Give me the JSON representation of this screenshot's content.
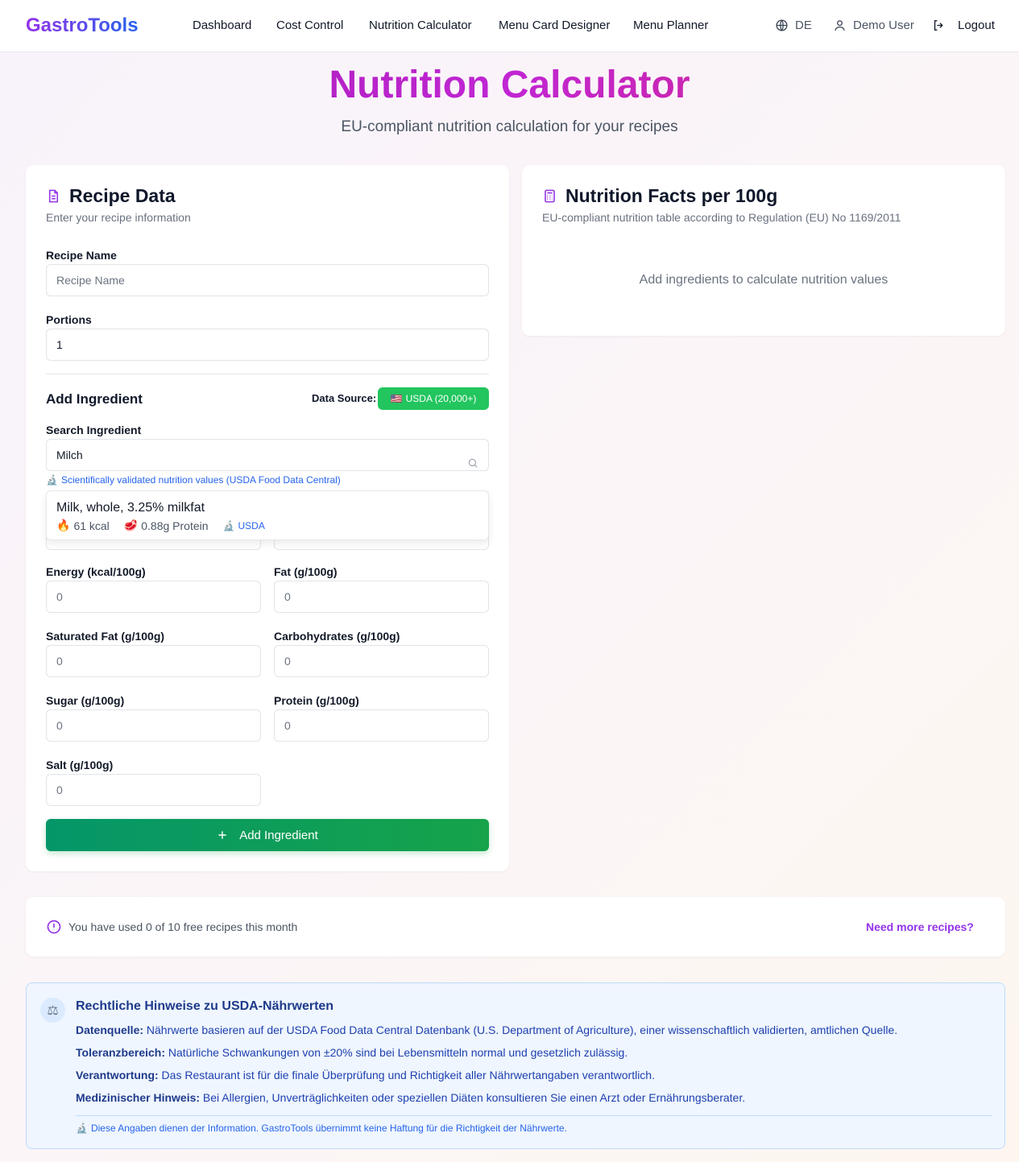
{
  "nav": {
    "logo": "GastroTools",
    "links": [
      "Dashboard",
      "Cost Control",
      "Nutrition Calculator",
      "Menu Card Designer",
      "Menu Planner"
    ],
    "language": "DE",
    "user": "Demo User",
    "logout": "Logout"
  },
  "header": {
    "title": "Nutrition Calculator",
    "subtitle": "EU-compliant nutrition calculation for your recipes"
  },
  "recipe": {
    "title": "Recipe Data",
    "subtitle": "Enter your recipe information",
    "name_label": "Recipe Name",
    "name_placeholder": "Recipe Name",
    "portions_label": "Portions",
    "portions_value": "1",
    "add_heading": "Add Ingredient",
    "data_source_label": "Data Source:",
    "data_source_flag": "🇺🇸",
    "data_source_value": "USDA (20,000+)",
    "search_label": "Search Ingredient",
    "search_value": "Milch",
    "validated_note": "Scientifically validated nutrition values (USDA Food Data Central)",
    "suggestion": {
      "name": "Milk, whole, 3.25% milkfat",
      "kcal": "61 kcal",
      "protein": "0.88g Protein",
      "source": "USDA"
    },
    "fields": [
      {
        "label": "Energy (kcal/100g)",
        "placeholder": "0"
      },
      {
        "label": "Fat (g/100g)",
        "placeholder": "0"
      },
      {
        "label": "Saturated Fat (g/100g)",
        "placeholder": "0"
      },
      {
        "label": "Carbohydrates (g/100g)",
        "placeholder": "0"
      },
      {
        "label": "Sugar (g/100g)",
        "placeholder": "0"
      },
      {
        "label": "Protein (g/100g)",
        "placeholder": "0"
      },
      {
        "label": "Salt (g/100g)",
        "placeholder": "0"
      }
    ],
    "add_button": "Add Ingredient"
  },
  "facts": {
    "title": "Nutrition Facts per 100g",
    "subtitle": "EU-compliant nutrition table according to Regulation (EU) No 1169/2011",
    "empty": "Add ingredients to calculate nutrition values"
  },
  "usage": {
    "text": "You have used 0 of 10 free recipes this month",
    "link": "Need more recipes?"
  },
  "legal": {
    "title": "Rechtliche Hinweise zu USDA-Nährwerten",
    "lines": [
      {
        "label": "Datenquelle:",
        "text": " Nährwerte basieren auf der USDA Food Data Central Datenbank (U.S. Department of Agriculture), einer wissenschaftlich validierten, amtlichen Quelle."
      },
      {
        "label": "Toleranzbereich:",
        "text": " Natürliche Schwankungen von ±20% sind bei Lebensmitteln normal und gesetzlich zulässig."
      },
      {
        "label": "Verantwortung:",
        "text": " Das Restaurant ist für die finale Überprüfung und Richtigkeit aller Nährwertangaben verantwortlich."
      },
      {
        "label": "Medizinischer Hinweis:",
        "text": " Bei Allergien, Unverträglichkeiten oder speziellen Diäten konsultieren Sie einen Arzt oder Ernährungsberater."
      }
    ],
    "footnote": "Diese Angaben dienen der Information. GastroTools übernimmt keine Haftung für die Richtigkeit der Nährwerte."
  },
  "colors": {
    "accent": "#9333ea",
    "success": "#22c55e",
    "info": "#1e40af"
  }
}
